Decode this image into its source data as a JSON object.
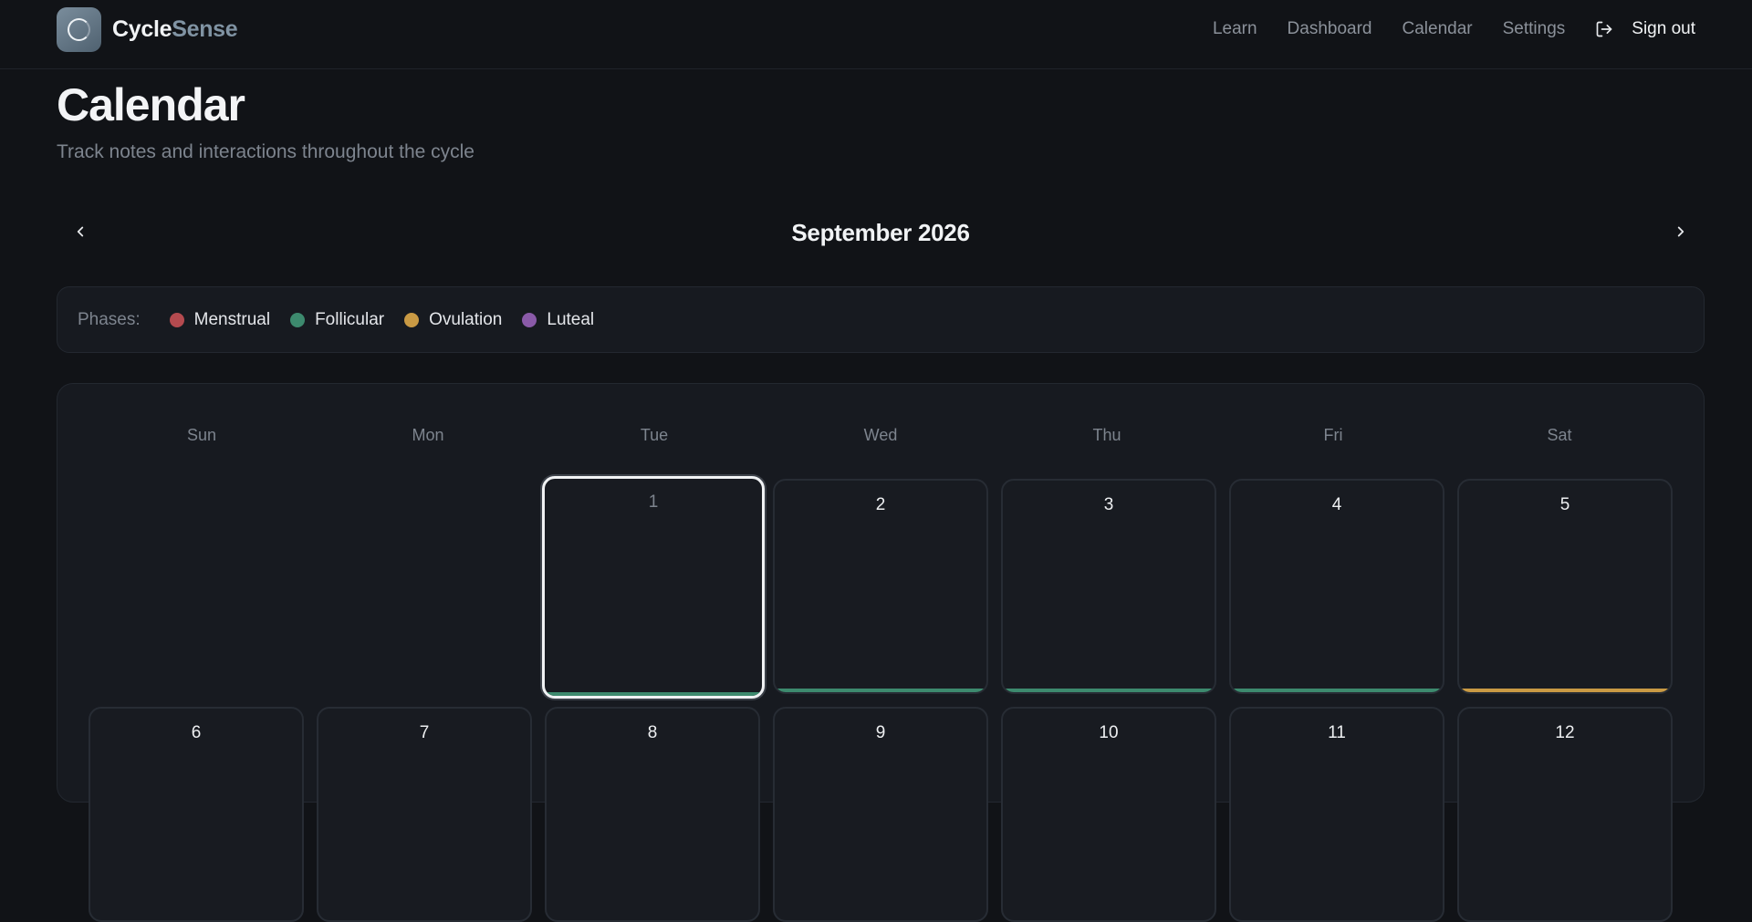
{
  "brand": {
    "name_a": "Cycle",
    "name_b": "Sense"
  },
  "nav": {
    "links": [
      "Learn",
      "Dashboard",
      "Calendar",
      "Settings"
    ],
    "signout_label": "Sign out"
  },
  "page": {
    "title": "Calendar",
    "subtitle": "Track notes and interactions throughout the cycle"
  },
  "month_nav": {
    "label": "September 2026"
  },
  "legend": {
    "title": "Phases:",
    "items": [
      {
        "label": "Menstrual",
        "color": "#b44a4f"
      },
      {
        "label": "Follicular",
        "color": "#3d8a6e"
      },
      {
        "label": "Ovulation",
        "color": "#c99a44"
      },
      {
        "label": "Luteal",
        "color": "#8a5aa8"
      }
    ]
  },
  "calendar": {
    "weekdays": [
      "Sun",
      "Mon",
      "Tue",
      "Wed",
      "Thu",
      "Fri",
      "Sat"
    ],
    "days": [
      {
        "num": "1",
        "phase_color": "#3d8a6e",
        "selected": true
      },
      {
        "num": "2",
        "phase_color": "#3d8a6e"
      },
      {
        "num": "3",
        "phase_color": "#3d8a6e"
      },
      {
        "num": "4",
        "phase_color": "#3d8a6e"
      },
      {
        "num": "5",
        "phase_color": "#c99a44"
      },
      {
        "num": "6"
      },
      {
        "num": "7"
      },
      {
        "num": "8"
      },
      {
        "num": "9"
      },
      {
        "num": "10"
      },
      {
        "num": "11"
      },
      {
        "num": "12"
      }
    ]
  }
}
